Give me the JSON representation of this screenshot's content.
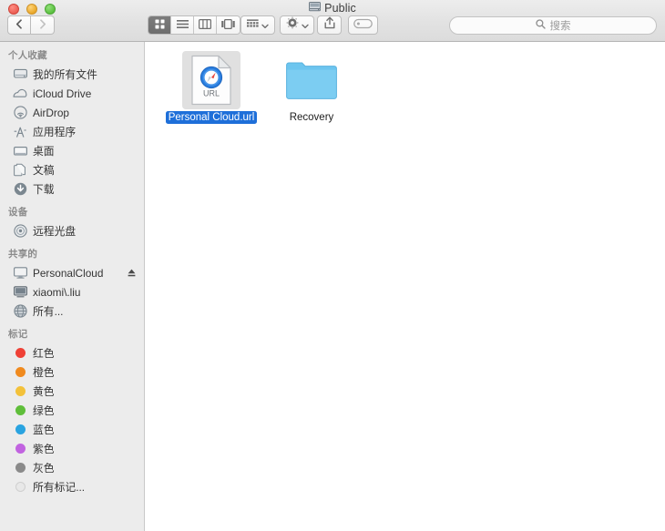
{
  "window": {
    "title": "Public",
    "title_icon": "network-drive-icon",
    "traffic_lights": [
      {
        "name": "close-button",
        "color": "#ec5f55"
      },
      {
        "name": "minimize-button",
        "color": "#e9a82a"
      },
      {
        "name": "maximize-button",
        "color": "#5bc040"
      }
    ]
  },
  "toolbar": {
    "back_label": "‹",
    "forward_label": "›",
    "view_modes": [
      {
        "name": "icon-view",
        "icon": "grid-view-icon",
        "active": true
      },
      {
        "name": "list-view",
        "icon": "list-view-icon",
        "active": false
      },
      {
        "name": "column-view",
        "icon": "column-view-icon",
        "active": false
      },
      {
        "name": "coverflow-view",
        "icon": "coverflow-view-icon",
        "active": false
      }
    ],
    "arrange_button": {
      "name": "arrange-by-button",
      "icon": "grid-arrange-icon"
    },
    "action_button": {
      "name": "action-button",
      "icon": "gear-icon"
    },
    "share_button": {
      "name": "share-button",
      "icon": "share-icon"
    },
    "tag_button": {
      "name": "edit-tags-button",
      "icon": "tag-icon"
    }
  },
  "search": {
    "placeholder": "搜索",
    "value": "",
    "icon": "search-icon"
  },
  "sidebar": {
    "sections": [
      {
        "header": "个人收藏",
        "items": [
          {
            "label": "我的所有文件",
            "icon": "hard-drive-icon"
          },
          {
            "label": "iCloud Drive",
            "icon": "cloud-icon"
          },
          {
            "label": "AirDrop",
            "icon": "airdrop-icon"
          },
          {
            "label": "应用程序",
            "icon": "applications-icon"
          },
          {
            "label": "桌面",
            "icon": "desktop-icon"
          },
          {
            "label": "文稿",
            "icon": "documents-icon"
          },
          {
            "label": "下载",
            "icon": "downloads-icon"
          }
        ]
      },
      {
        "header": "设备",
        "items": [
          {
            "label": "远程光盘",
            "icon": "optical-disc-icon"
          }
        ]
      },
      {
        "header": "共享的",
        "items": [
          {
            "label": "PersonalCloud",
            "icon": "display-icon",
            "eject": true
          },
          {
            "label": "xiaomi\\.liu",
            "icon": "monitor-icon"
          },
          {
            "label": "所有...",
            "icon": "globe-icon"
          }
        ]
      },
      {
        "header": "标记",
        "items": [
          {
            "label": "红色",
            "icon": "tag-dot-icon",
            "color": "#ef4136"
          },
          {
            "label": "橙色",
            "icon": "tag-dot-icon",
            "color": "#f08a1e"
          },
          {
            "label": "黄色",
            "icon": "tag-dot-icon",
            "color": "#f3c13a"
          },
          {
            "label": "绿色",
            "icon": "tag-dot-icon",
            "color": "#5fbe3a"
          },
          {
            "label": "蓝色",
            "icon": "tag-dot-icon",
            "color": "#29a3e0"
          },
          {
            "label": "紫色",
            "icon": "tag-dot-icon",
            "color": "#c163e0"
          },
          {
            "label": "灰色",
            "icon": "tag-dot-icon",
            "color": "#8a8a8a"
          },
          {
            "label": "所有标记...",
            "icon": "tag-dot-outline-icon",
            "color": "#e4e4e4"
          }
        ]
      }
    ]
  },
  "main": {
    "items": [
      {
        "name": "Personal Cloud.url",
        "icon": "url-document-icon",
        "badge_text": "URL",
        "selected": true
      },
      {
        "name": "Recovery",
        "icon": "folder-icon",
        "selected": false
      }
    ]
  },
  "colors": {
    "selection_blue": "#1e6fd9",
    "folder_blue": "#6cc5ef",
    "sidebar_bg": "#ececec",
    "titlebar_bg": "#e4e4e4"
  }
}
